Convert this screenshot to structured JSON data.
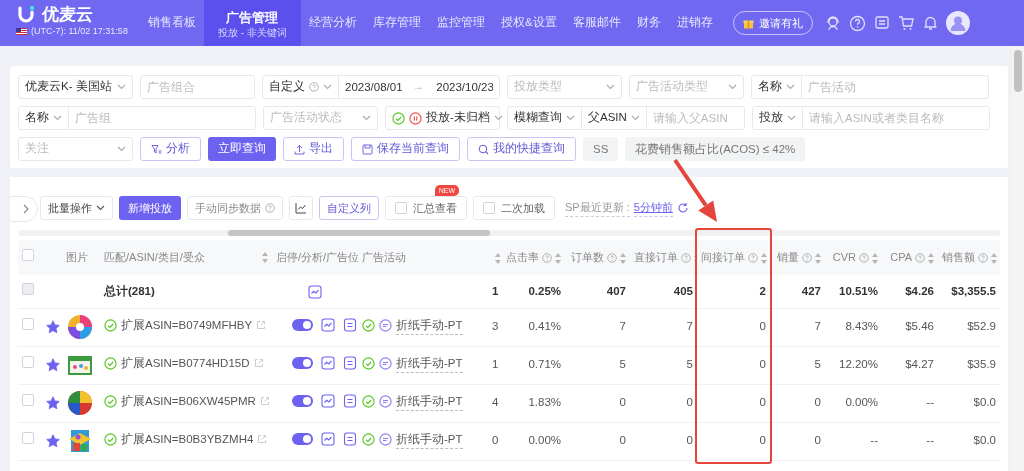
{
  "nav": {
    "logo": "优麦云",
    "clock": "(UTC-7): 11/02 17:31:58",
    "items": [
      {
        "label": "销售看板",
        "selected": false
      },
      {
        "label": "广告管理",
        "sub": "投放 - 非关键词",
        "selected": true
      },
      {
        "label": "经营分析",
        "selected": false
      },
      {
        "label": "库存管理",
        "selected": false
      },
      {
        "label": "监控管理",
        "selected": false
      },
      {
        "label": "授权&设置",
        "selected": false
      },
      {
        "label": "客服邮件",
        "selected": false
      },
      {
        "label": "财务",
        "selected": false
      },
      {
        "label": "进销存",
        "selected": false
      }
    ],
    "invite": "邀请有礼"
  },
  "filters": [
    [
      {
        "kind": "select",
        "value": "优麦云K- 美国站"
      },
      {
        "kind": "input",
        "placeholder": "广告组合"
      },
      {
        "kind": "group",
        "parts": [
          {
            "kind": "select",
            "value": "自定义",
            "help": true
          },
          {
            "kind": "date",
            "value": "2023/08/01"
          },
          {
            "kind": "text",
            "text": "→"
          },
          {
            "kind": "date",
            "value": "2023/10/23"
          }
        ]
      },
      {
        "kind": "select",
        "placeholder": "投放类型"
      },
      {
        "kind": "select",
        "placeholder": "广告活动类型"
      },
      {
        "kind": "group",
        "parts": [
          {
            "kind": "select",
            "value": "名称"
          },
          {
            "kind": "input",
            "placeholder": "广告活动"
          }
        ]
      }
    ],
    [
      {
        "kind": "group",
        "parts": [
          {
            "kind": "select",
            "value": "名称"
          },
          {
            "kind": "input",
            "placeholder": "广告组"
          }
        ]
      },
      {
        "kind": "select",
        "placeholder": "广告活动状态"
      },
      {
        "kind": "status_select",
        "value": "投放-未归档"
      },
      {
        "kind": "group",
        "parts": [
          {
            "kind": "select",
            "value": "模糊查询"
          },
          {
            "kind": "select",
            "value": "父ASIN"
          },
          {
            "kind": "input",
            "placeholder": "请输入父ASIN"
          }
        ]
      },
      {
        "kind": "group",
        "parts": [
          {
            "kind": "select",
            "value": "投放"
          },
          {
            "kind": "input",
            "placeholder": "请输入ASIN或者类目名称"
          }
        ]
      }
    ],
    [
      {
        "kind": "select",
        "placeholder": "关注"
      },
      {
        "kind": "button",
        "label": "分析"
      },
      {
        "kind": "primary_button",
        "label": "立即查询"
      },
      {
        "kind": "button",
        "label": "导出"
      },
      {
        "kind": "button",
        "label": "保存当前查询"
      },
      {
        "kind": "button",
        "label": "我的快捷查询"
      },
      {
        "kind": "tag",
        "label": "SS"
      },
      {
        "kind": "tag",
        "label": "花费销售额占比(ACOS) ≤ 42%"
      }
    ]
  ],
  "toolbar": {
    "items": [
      {
        "kind": "dropdown",
        "label": "批量操作"
      },
      {
        "kind": "primary_button",
        "label": "新增投放"
      },
      {
        "kind": "button",
        "label": "手动同步数据",
        "help": true
      },
      {
        "kind": "icon_button"
      },
      {
        "kind": "button",
        "label": "自定义列",
        "help": false
      },
      {
        "kind": "checkbox",
        "label": "汇总查看",
        "checked": false,
        "badge": "NEW"
      },
      {
        "kind": "checkbox",
        "label": "二次加载",
        "checked": false
      },
      {
        "kind": "status",
        "label": "SP最近更新 :",
        "link": "5分钟前"
      }
    ]
  },
  "table": {
    "columns": [
      {
        "kind": "checkbox",
        "checked": false
      },
      {
        "kind": "star"
      },
      {
        "kind": "text",
        "label": "图片"
      },
      {
        "kind": "text",
        "label": "匹配/ASIN/类目/受众",
        "sortable": true
      },
      {
        "kind": "text",
        "label": "启停/分析/广告位"
      },
      {
        "kind": "text",
        "label": "广告活动"
      },
      {
        "kind": "num",
        "sortable": true
      },
      {
        "kind": "num",
        "label": "点击率",
        "help": true,
        "sortable": true
      },
      {
        "kind": "num",
        "label": "订单数",
        "help": true,
        "sortable": true
      },
      {
        "kind": "num",
        "label": "直接订单",
        "help": true,
        "sortable": true
      },
      {
        "kind": "num",
        "label": "间接订单",
        "help": true,
        "sortable": true,
        "highlighted": true
      },
      {
        "kind": "num",
        "label": "销量",
        "help": true,
        "sortable": true
      },
      {
        "kind": "num",
        "label": "CVR",
        "help": true,
        "sortable": true
      },
      {
        "kind": "num",
        "label": "CPA",
        "help": true,
        "sortable": true
      },
      {
        "kind": "num",
        "label": "销售额",
        "help": true,
        "sortable": true
      }
    ],
    "rows": [
      {
        "kind": "total",
        "checked": false,
        "disabled": true,
        "label": "总计(281)",
        "values": [
          "1",
          "0.25%",
          "407",
          "405",
          "2",
          "427",
          "10.51%",
          "$4.26",
          "$3,355.5"
        ]
      },
      {
        "kind": "item",
        "checked": false,
        "starred": true,
        "asin": "扩展ASIN=B0749MFHBY",
        "enabled": true,
        "campaign": "折纸手动-PT",
        "values": [
          "3",
          "0.41%",
          "7",
          "7",
          "0",
          "7",
          "8.43%",
          "$5.46",
          "$52.9"
        ]
      },
      {
        "kind": "item",
        "checked": false,
        "starred": true,
        "asin": "扩展ASIN=B0774HD15D",
        "enabled": true,
        "campaign": "折纸手动-PT",
        "values": [
          "1",
          "0.71%",
          "5",
          "5",
          "0",
          "5",
          "12.20%",
          "$4.27",
          "$35.9"
        ]
      },
      {
        "kind": "item",
        "checked": false,
        "starred": true,
        "asin": "扩展ASIN=B06XW45PMR",
        "enabled": true,
        "campaign": "折纸手动-PT",
        "values": [
          "4",
          "1.83%",
          "0",
          "0",
          "0",
          "0",
          "0.00%",
          "--",
          "$0.0"
        ]
      },
      {
        "kind": "item",
        "checked": false,
        "starred": true,
        "asin": "扩展ASIN=B0B3YBZMH4",
        "enabled": true,
        "campaign": "折纸手动-PT",
        "values": [
          "0",
          "0.00%",
          "0",
          "0",
          "0",
          "0",
          "--",
          "--",
          "$0.0"
        ]
      }
    ]
  }
}
